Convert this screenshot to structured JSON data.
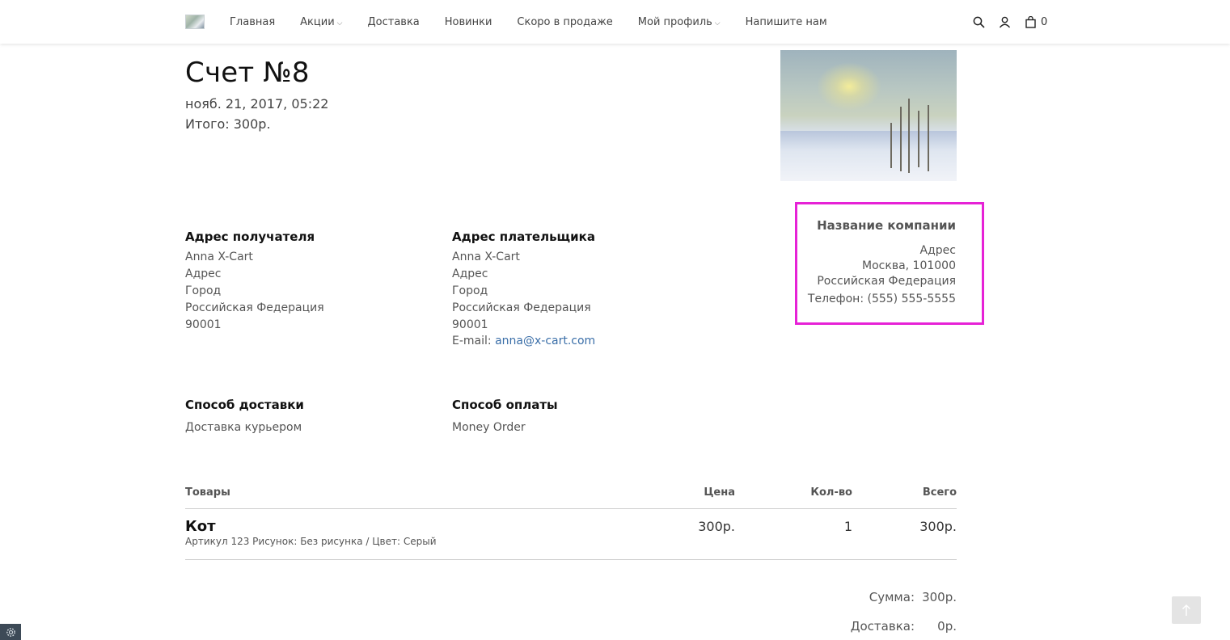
{
  "nav": {
    "items": [
      {
        "label": "Главная"
      },
      {
        "label": "Акции",
        "dropdown": true
      },
      {
        "label": "Доставка"
      },
      {
        "label": "Новинки"
      },
      {
        "label": "Скоро в продаже"
      },
      {
        "label": "Мой профиль",
        "dropdown": true
      },
      {
        "label": "Напишите нам"
      }
    ],
    "cart_count": "0",
    "icons": [
      "search-icon",
      "user-icon",
      "cart-icon"
    ]
  },
  "invoice": {
    "title": "Счет №8",
    "date": "нояб. 21, 2017, 05:22",
    "total": "Итого: 300р."
  },
  "company": {
    "name": "Название компании",
    "address": "Адрес",
    "city": "Москва, 101000",
    "country": "Российская Федерация",
    "phone": "Телефон: (555) 555-5555",
    "highlight_color": "#e622d6"
  },
  "shipping_address": {
    "heading": "Адрес получателя",
    "lines": [
      "Anna X-Cart",
      "Адрес",
      "Город",
      "Российская Федерация",
      "90001"
    ]
  },
  "billing_address": {
    "heading": "Адрес плательщика",
    "lines": [
      "Anna X-Cart",
      "Адрес",
      "Город",
      "Российская Федерация",
      "90001"
    ],
    "email_label": "E-mail:",
    "email": "anna@x-cart.com"
  },
  "delivery": {
    "heading": "Способ доставки",
    "value": "Доставка курьером"
  },
  "payment": {
    "heading": "Способ оплаты",
    "value": "Money Order"
  },
  "items_table": {
    "headers": {
      "product": "Товары",
      "price": "Цена",
      "qty": "Кол-во",
      "total": "Всего"
    },
    "rows": [
      {
        "name": "Кот",
        "attrs": "Артикул 123  Рисунок: Без рисунка / Цвет: Серый",
        "price": "300р.",
        "qty": "1",
        "total": "300р."
      }
    ]
  },
  "summary": {
    "subtotal_label": "Сумма:",
    "subtotal": "300р.",
    "shipping_label": "Доставка:",
    "shipping": "0р."
  }
}
